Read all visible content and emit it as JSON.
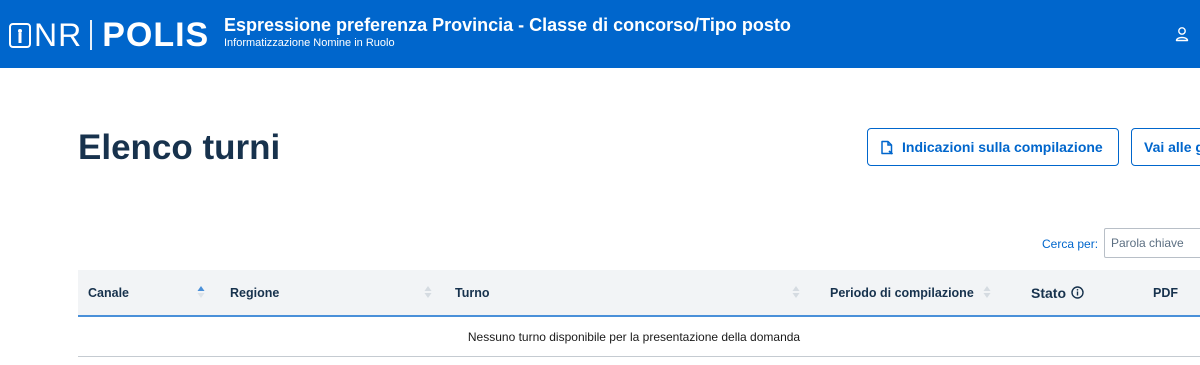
{
  "header": {
    "logo_prefix": "NR",
    "logo_main": "POLIS",
    "title": "Espressione preferenza Provincia - Classe di concorso/Tipo posto",
    "subtitle": "Informatizzazione Nomine in Ruolo",
    "user_icon": "user-icon"
  },
  "page": {
    "title": "Elenco turni",
    "instructions_button": "Indicazioni sulla compilazione",
    "goto_button": "Vai alle g"
  },
  "search": {
    "label": "Cerca per:",
    "placeholder": "Parola chiave"
  },
  "table": {
    "columns": [
      "Canale",
      "Regione",
      "Turno",
      "Periodo di compilazione",
      "Stato",
      "PDF"
    ],
    "sort_active_column": "Canale",
    "empty_message": "Nessuno turno disponibile per la presentazione della domanda"
  },
  "colors": {
    "header_bg": "#0066cc",
    "accent": "#0066cc",
    "title": "#17324d"
  }
}
